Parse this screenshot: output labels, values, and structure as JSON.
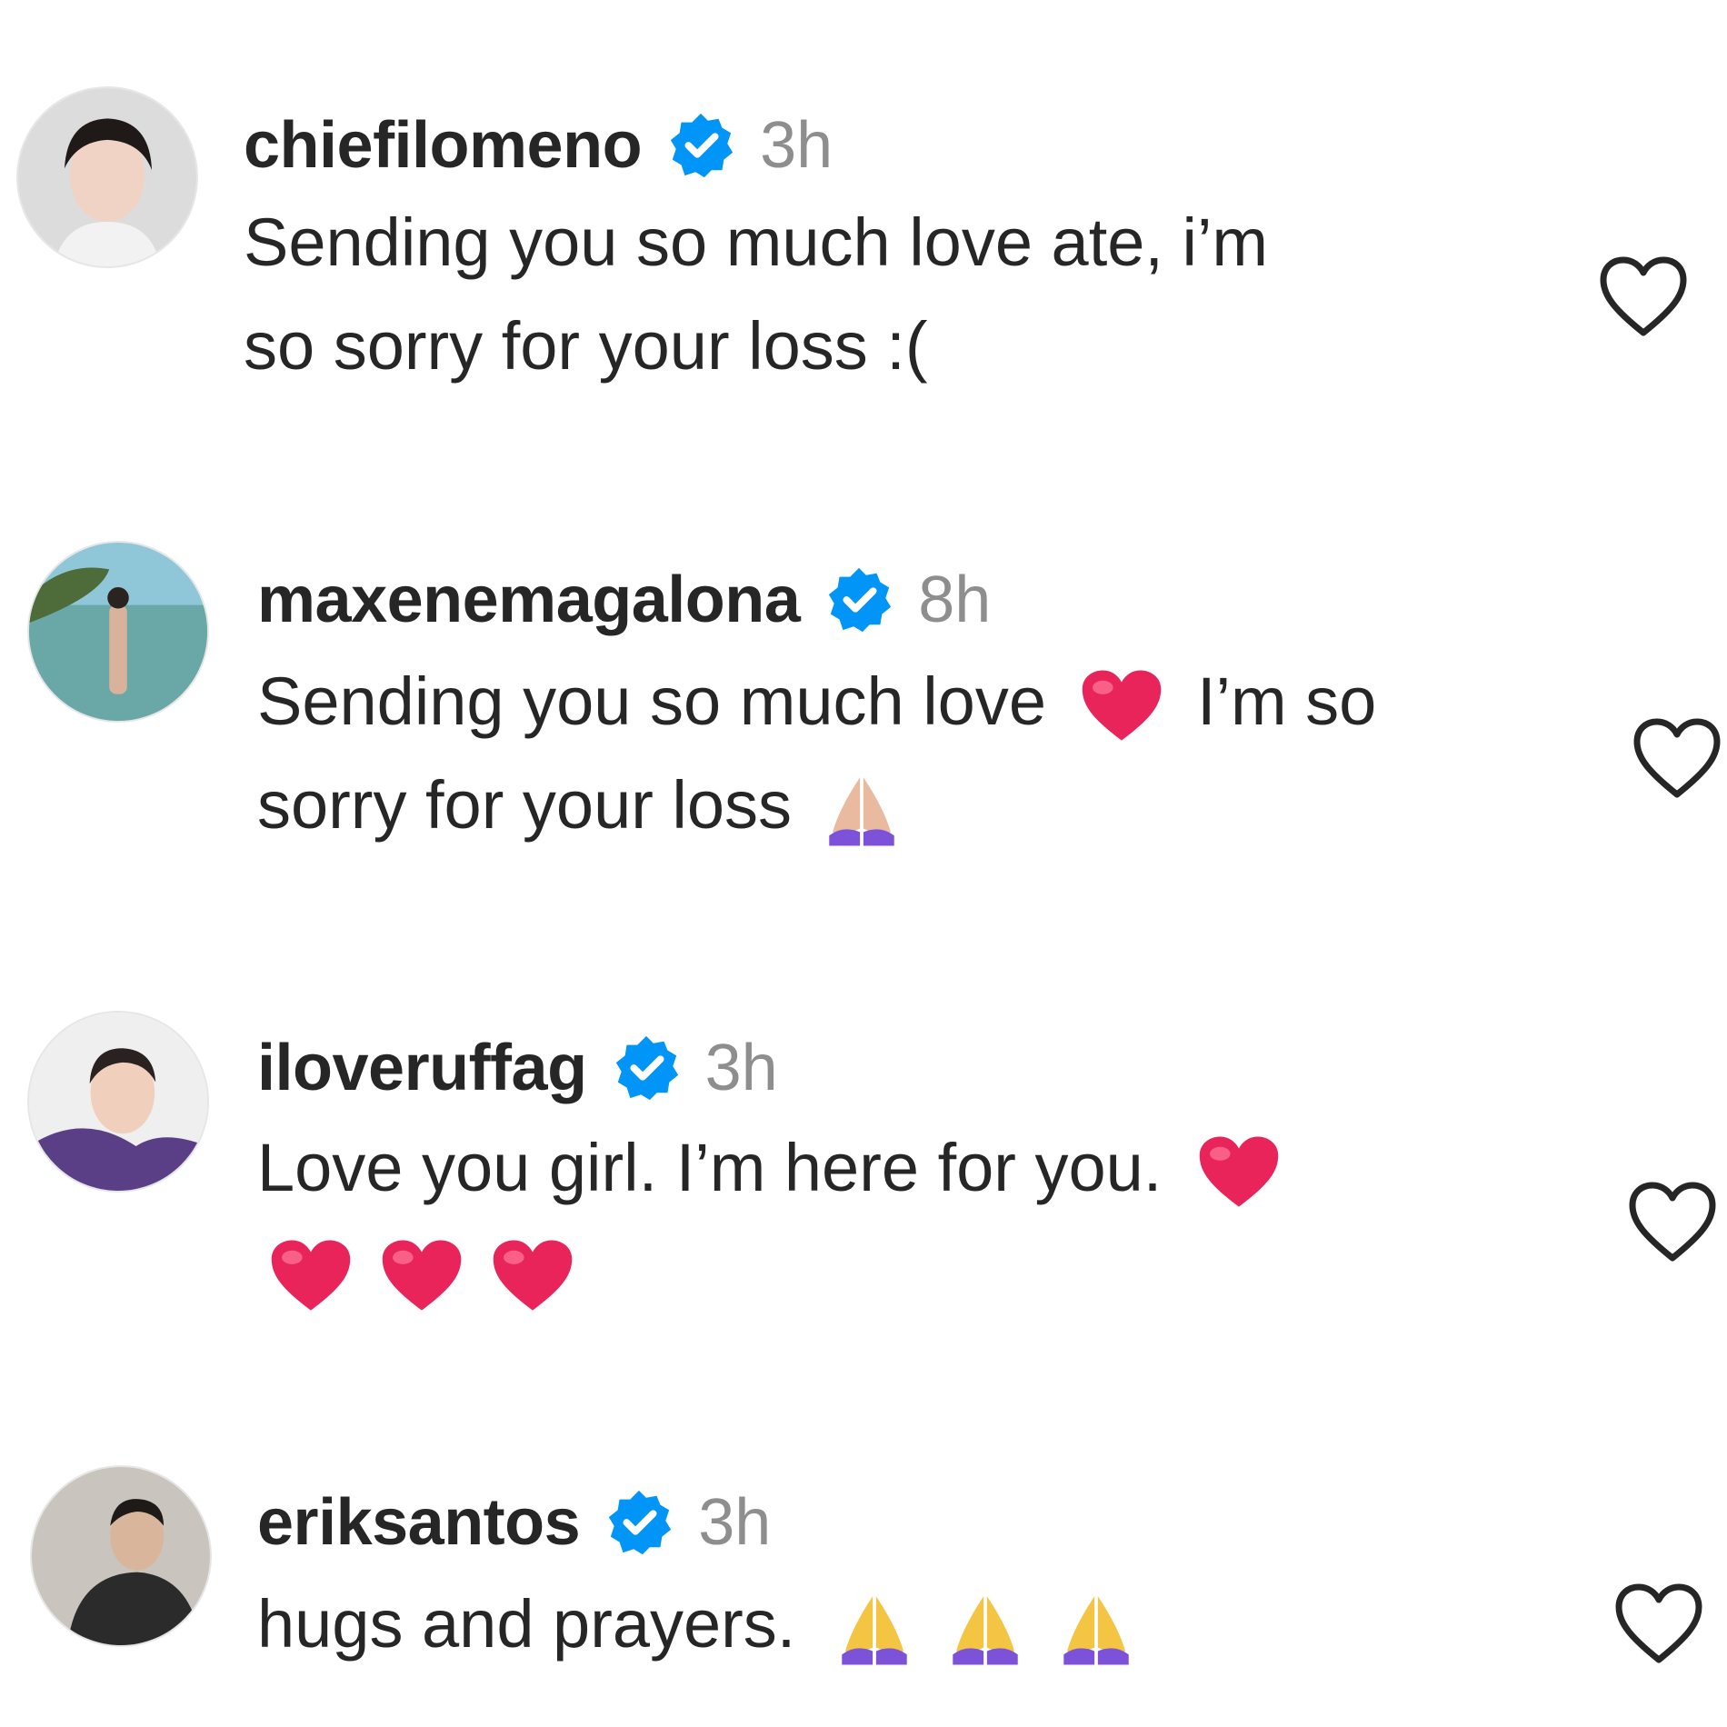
{
  "comments": [
    {
      "username": "chiefilomeno",
      "verified": true,
      "time": "3h",
      "line1": "Sending you so much love ate, i’m",
      "line2": "so sorry for your loss :(",
      "avatar_icon": "profile-photo"
    },
    {
      "username": "maxenemagalona",
      "verified": true,
      "time": "8h",
      "line1_a": "Sending you so much love",
      "line1_b": "I’m so",
      "line2": "sorry for your loss",
      "emojis": [
        "red-heart",
        "folded-hands-light"
      ],
      "avatar_icon": "profile-photo-beach"
    },
    {
      "username": "iloveruffag",
      "verified": true,
      "time": "3h",
      "line1": "Love you girl. I’m here for you.",
      "emojis": [
        "red-heart",
        "red-heart",
        "red-heart",
        "red-heart"
      ],
      "avatar_icon": "profile-photo"
    },
    {
      "username": "eriksantos",
      "verified": true,
      "time": "3h",
      "line1": "hugs and prayers.",
      "emojis": [
        "folded-hands",
        "folded-hands",
        "folded-hands"
      ],
      "avatar_icon": "profile-photo"
    }
  ],
  "colors": {
    "verified_blue": "#0095f6",
    "text": "#262626",
    "secondary": "#8e8e8e",
    "heart_red": "#e8245a"
  }
}
